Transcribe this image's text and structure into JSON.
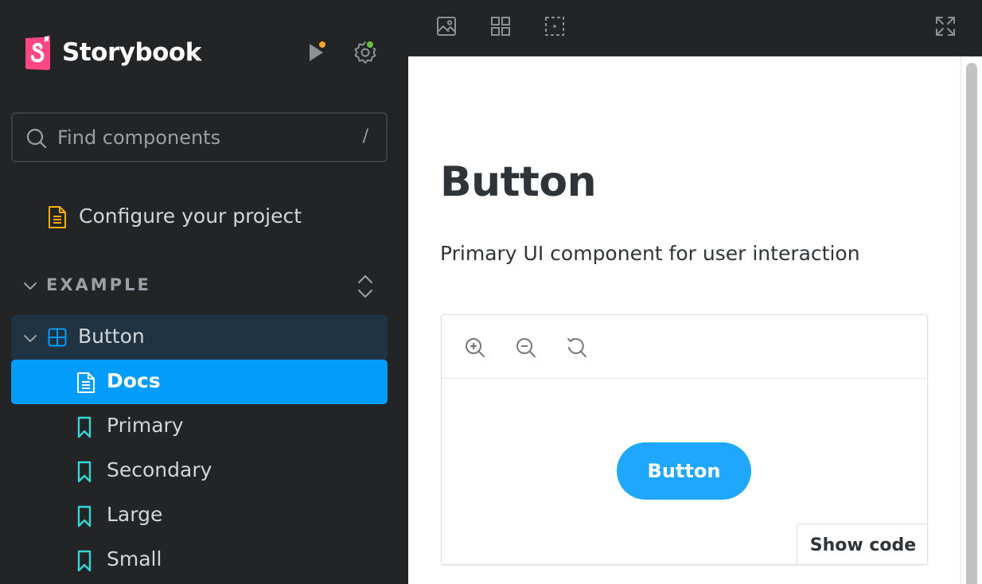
{
  "app": {
    "name": "Storybook"
  },
  "search": {
    "placeholder": "Find components",
    "shortcut": "/"
  },
  "sidebar": {
    "configure_label": "Configure your project",
    "section_label": "EXAMPLE",
    "component_label": "Button",
    "stories": [
      {
        "label": "Docs",
        "icon": "document-icon",
        "selected": true
      },
      {
        "label": "Primary",
        "icon": "bookmark-icon"
      },
      {
        "label": "Secondary",
        "icon": "bookmark-icon"
      },
      {
        "label": "Large",
        "icon": "bookmark-icon"
      },
      {
        "label": "Small",
        "icon": "bookmark-icon"
      }
    ]
  },
  "toolbar": {
    "icons": [
      "image-icon",
      "grid-icon",
      "measure-icon",
      "fullscreen-icon"
    ]
  },
  "doc": {
    "title": "Button",
    "description": "Primary UI component for user interaction",
    "demo_button_label": "Button",
    "show_code_label": "Show code"
  },
  "colors": {
    "sidebar_bg": "#222425",
    "accent": "#029cfd",
    "demo_button": "#1ea7fd",
    "brand_logo": "#ff4785",
    "notification_orange": "#f5a623",
    "status_green": "#66bf3c",
    "story_icon_teal": "#37d5d3",
    "doc_icon_orange": "#ffae00"
  }
}
